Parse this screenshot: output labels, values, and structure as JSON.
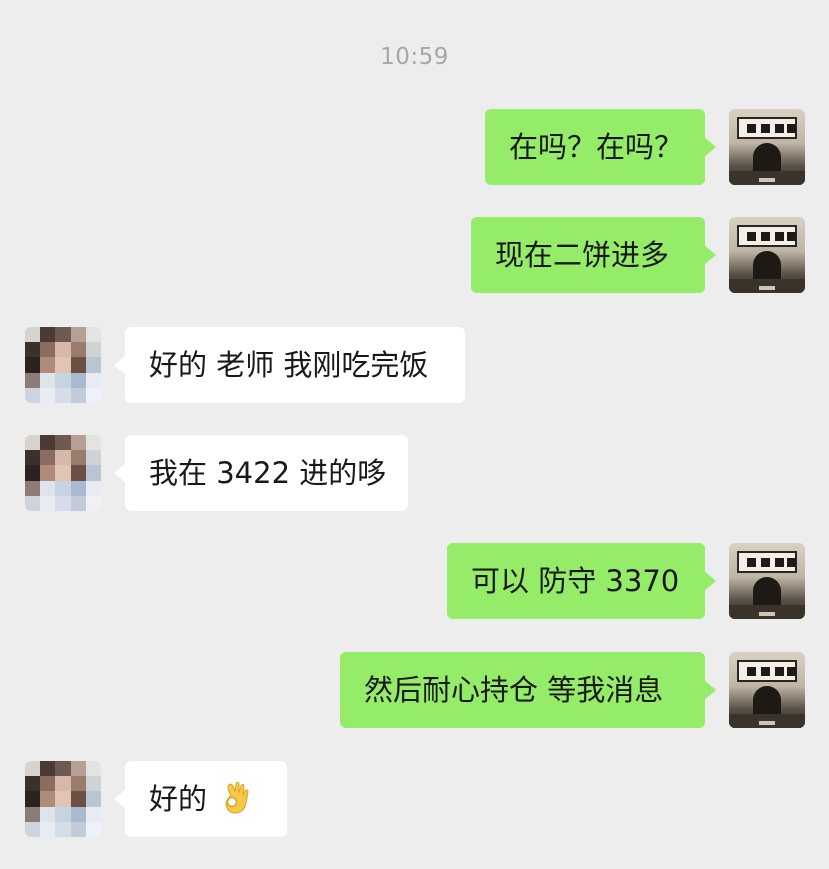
{
  "chat": {
    "timestamp": "10:59",
    "messages": [
      {
        "sender": "self",
        "text": "在吗？在吗？"
      },
      {
        "sender": "self",
        "text": "现在二饼进多"
      },
      {
        "sender": "other",
        "text": "好的 老师 我刚吃完饭"
      },
      {
        "sender": "other",
        "text": "我在 3422 进的哆"
      },
      {
        "sender": "self",
        "text": "可以 防守 3370"
      },
      {
        "sender": "self",
        "text": "然后耐心持仓 等我消息"
      },
      {
        "sender": "other",
        "text": "好的",
        "emoji": "ok-hand-emoji"
      }
    ]
  },
  "colors": {
    "background": "#ededed",
    "outgoing_bubble": "#95ec69",
    "incoming_bubble": "#ffffff",
    "timestamp": "#a7a7a7"
  }
}
